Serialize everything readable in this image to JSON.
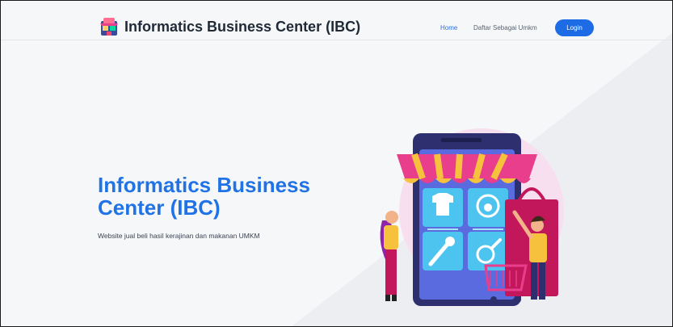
{
  "brand": {
    "name": "Informatics Business Center (IBC)",
    "logo_icon": "shop-icon"
  },
  "nav": {
    "home": "Home",
    "register": "Daftar Sebagai Umkm",
    "login": "Login"
  },
  "hero": {
    "title": "Informatics Business Center (IBC)",
    "subtitle": "Website jual beli hasil kerajinan dan makanan UMKM",
    "illustration_icon": "online-shop-illustration"
  },
  "colors": {
    "accent": "#1e6be6",
    "title": "#1f73e6",
    "background": "#f6f7f9",
    "awning_pink": "#e83e8c",
    "awning_yellow": "#f6c23e"
  }
}
